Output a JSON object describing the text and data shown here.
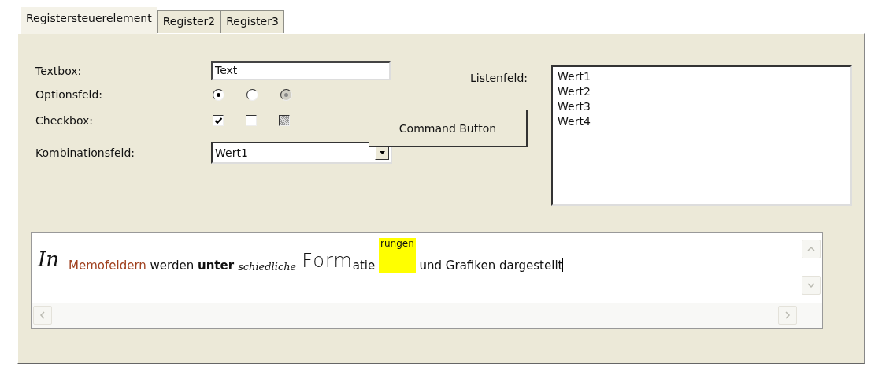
{
  "tabs": [
    {
      "label": "Registersteuerelement",
      "selected": true
    },
    {
      "label": "Register2",
      "selected": false
    },
    {
      "label": "Register3",
      "selected": false
    }
  ],
  "textbox": {
    "label": "Textbox:",
    "value": "Text"
  },
  "options": {
    "label": "Optionsfeld:",
    "items": [
      {
        "selected": true,
        "disabled": false
      },
      {
        "selected": false,
        "disabled": false
      },
      {
        "selected": true,
        "disabled": true
      }
    ]
  },
  "checkboxes": {
    "label": "Checkbox:",
    "items": [
      {
        "checked": true,
        "indeterminate": false
      },
      {
        "checked": false,
        "indeterminate": false
      },
      {
        "checked": false,
        "indeterminate": true
      }
    ]
  },
  "combo": {
    "label": "Kombinationsfeld:",
    "value": "Wert1"
  },
  "command_button": {
    "label": "Command Button"
  },
  "listbox": {
    "label": "Listenfeld:",
    "items": [
      "Wert1",
      "Wert2",
      "Wert3",
      "Wert4"
    ]
  },
  "memo": {
    "runs": [
      {
        "text": "In",
        "kind": "script"
      },
      {
        "text": "Memofeldern",
        "kind": "colored",
        "color": "#a0401e"
      },
      {
        "text": " werden ",
        "kind": "plain"
      },
      {
        "text": "unter",
        "kind": "bold"
      },
      {
        "text": "schiedliche",
        "kind": "fancy"
      },
      {
        "text": "Form",
        "kind": "large"
      },
      {
        "text": "atie ",
        "kind": "plain"
      },
      {
        "text": "rungen",
        "kind": "highlight"
      },
      {
        "text": " und Grafiken dargestellt",
        "kind": "plain"
      }
    ]
  }
}
